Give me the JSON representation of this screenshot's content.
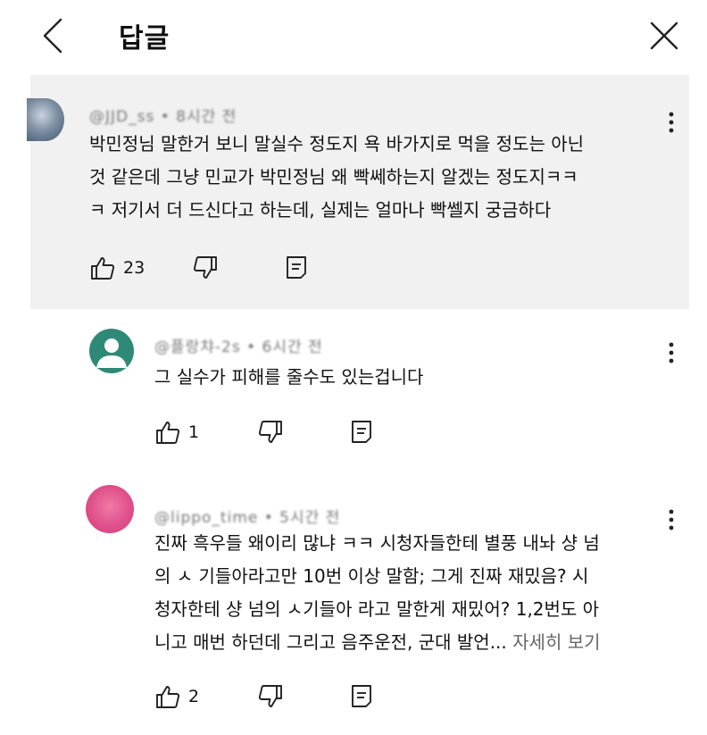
{
  "header": {
    "title": "답글"
  },
  "icons": {
    "back": "chevron-left-icon",
    "close": "close-icon",
    "more": "more-vert-icon",
    "like": "thumbs-up-icon",
    "dislike": "thumbs-down-icon",
    "reply": "reply-icon"
  },
  "comments": [
    {
      "avatar_color": "#6f8094",
      "meta": "@JJD_ss • 8시간 전",
      "text": "박민정님 말한거 보니 말실수 정도지 욕 바가지로 먹을 정도는 아닌\n것 같은데  그냥 민교가 박민정님 왜  빡쎄하는지 알겠는 정도지ㅋㅋ\nㅋ 저기서 더 드신다고 하는데, 실제는 얼마나 빡쎌지 궁금하다",
      "likes": "23"
    },
    {
      "avatar_color": "#2e8a76",
      "meta": "@플랑챠-2s • 6시간 전",
      "text": "그 실수가 피해를 줄수도 있는겁니다",
      "likes": "1"
    },
    {
      "avatar_color": "#e0508a",
      "meta": "@lippo_time • 5시간 전",
      "text": "진짜 흑우들 왜이리 많냐 ㅋㅋ 시청자들한테 별풍 내놔 샹 넘\n의 ㅅ 기들아라고만 10번 이상 말함; 그게 진짜 재밌음? 시\n청자한테 샹 넘의 ㅅ기들아 라고 말한게 재밌어? 1,2번도 아\n니고 매번 하던데 그리고 음주운전, 군대 발언... ",
      "more": "자세히 보기",
      "likes": "2"
    }
  ]
}
